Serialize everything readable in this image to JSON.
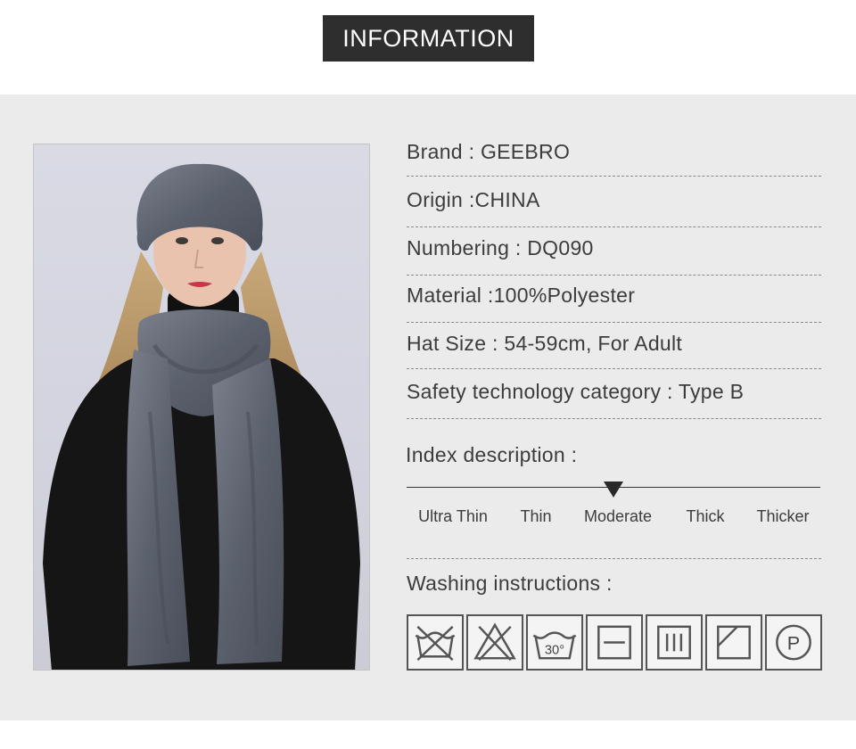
{
  "header": {
    "title": "INFORMATION"
  },
  "info": [
    "Brand : GEEBRO",
    "Origin :CHINA",
    "Numbering : DQ090",
    "Material :100%Polyester",
    "Hat Size : 54-59cm, For Adult",
    "Safety technology category : Type B"
  ],
  "index": {
    "title": "Index description :",
    "levels": [
      "Ultra Thin",
      "Thin",
      "Moderate",
      "Thick",
      "Thicker"
    ],
    "selected": "Moderate"
  },
  "washing": {
    "title": "Washing instructions :",
    "icons": [
      {
        "name": "do-not-wash-icon"
      },
      {
        "name": "do-not-bleach-icon"
      },
      {
        "name": "wash-30-icon",
        "label": "30°"
      },
      {
        "name": "dry-flat-icon"
      },
      {
        "name": "drip-dry-icon"
      },
      {
        "name": "dry-in-shade-icon"
      },
      {
        "name": "professional-dry-clean-icon",
        "label": "P"
      }
    ]
  },
  "photo": {
    "subject": "product-photo"
  },
  "colors": {
    "title_bg": "#2e2e2e",
    "panel_bg": "#ebebeb",
    "scarf": "#5d6370"
  }
}
